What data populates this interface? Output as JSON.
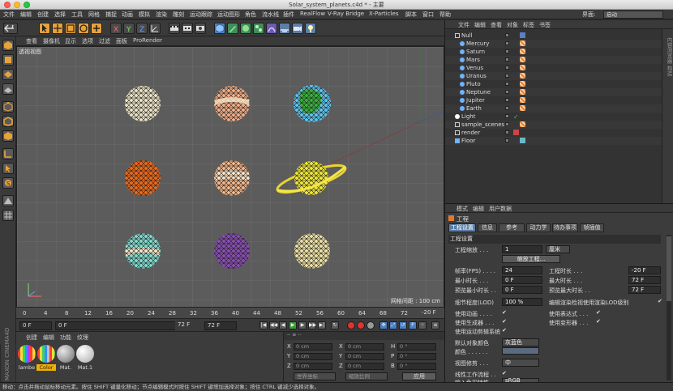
{
  "window": {
    "title": "Solar_system_planets.c4d * - 主要"
  },
  "menubar": {
    "items": [
      "文件",
      "编辑",
      "创建",
      "选择",
      "工具",
      "网格",
      "捕捉",
      "动画",
      "模拟",
      "渲染",
      "雕刻",
      "运动跟踪",
      "运动图形",
      "角色",
      "流水线",
      "插件",
      "RealFlow",
      "V-Ray Bridge",
      "X-Particles",
      "脚本",
      "窗口",
      "帮助"
    ],
    "layout_label": "界面:",
    "layout_value": "启动"
  },
  "toolbar": {
    "icons": [
      "undo-icon",
      "select-arrow-icon",
      "move-icon",
      "scale-icon",
      "rotate-icon",
      "add-icon",
      "x-axis-icon",
      "y-axis-icon",
      "z-axis-icon",
      "coordinate-system-icon",
      "render-view-icon",
      "render-picture-viewer-icon",
      "render-settings-icon",
      "cube-icon",
      "pen-icon",
      "subdivision-icon",
      "array-icon",
      "deformer-icon",
      "scene-icon",
      "camera-icon",
      "light-icon"
    ]
  },
  "viewport": {
    "menu": [
      "查看",
      "摄像机",
      "显示",
      "选项",
      "过滤",
      "面板",
      "ProRender"
    ],
    "label": "透视视图",
    "grid_spacing": "网格间距 : 100 cm",
    "colors": {
      "sky": "#5c5c5c",
      "grid": "#6a6a6a"
    }
  },
  "timeline": {
    "ticks": [
      "0",
      "4",
      "8",
      "12",
      "16",
      "20",
      "24",
      "28",
      "32",
      "36",
      "40",
      "44",
      "48",
      "52",
      "56",
      "60",
      "64",
      "68",
      "72"
    ],
    "current": "-20 F"
  },
  "transport": {
    "start_field": "0 F",
    "min_field": "0 F",
    "end_field": "72 F",
    "max_field": "72 F",
    "buttons": [
      "go-to-start-icon",
      "prev-key-icon",
      "prev-frame-icon",
      "play-icon",
      "next-frame-icon",
      "next-key-icon",
      "go-to-end-icon"
    ]
  },
  "material_panel": {
    "menu": [
      "创建",
      "编辑",
      "功能",
      "纹理"
    ],
    "materials": [
      {
        "label": "lambe",
        "color": "#7d5db6"
      },
      {
        "label": "Color",
        "color": "#2aa0b0",
        "selected": true
      },
      {
        "label": "Mat.",
        "color": "#aaaaaa"
      },
      {
        "label": "Mat.1",
        "color": "#f0f0f0"
      }
    ],
    "brand": "MAXON CINEMA4D"
  },
  "coord_panel": {
    "header": "--  ≡  --",
    "rows": [
      {
        "a": "X",
        "av": "0 cm",
        "b": "X",
        "bv": "0 cm",
        "c": "H",
        "cv": "0 °"
      },
      {
        "a": "Y",
        "av": "0 cm",
        "b": "Y",
        "bv": "0 cm",
        "c": "P",
        "cv": "0 °"
      },
      {
        "a": "Z",
        "av": "0 cm",
        "b": "Z",
        "bv": "0 cm",
        "c": "B",
        "cv": "0 °"
      }
    ],
    "mode_select": "世界坐标",
    "size_select": "缩放比例",
    "apply": "应用"
  },
  "object_manager": {
    "menu": [
      "文件",
      "编辑",
      "查看",
      "对象",
      "标签",
      "书签"
    ],
    "sidebar_label": "内容浏览器 构造",
    "objects": [
      {
        "name": "Null",
        "indent": 0,
        "icon_color": "#cfcfcf",
        "tag": "#5a7fc4"
      },
      {
        "name": "Mercury",
        "indent": 1,
        "icon_color": "#6fb3ff",
        "tag": "#e07a2e"
      },
      {
        "name": "Saturn",
        "indent": 1,
        "icon_color": "#6fb3ff",
        "tag": "#e07a2e"
      },
      {
        "name": "Mars",
        "indent": 1,
        "icon_color": "#6fb3ff",
        "tag": "#e07a2e"
      },
      {
        "name": "Venus",
        "indent": 1,
        "icon_color": "#6fb3ff",
        "tag": "#e07a2e"
      },
      {
        "name": "Uranus",
        "indent": 1,
        "icon_color": "#6fb3ff",
        "tag": "#e07a2e"
      },
      {
        "name": "Pluto",
        "indent": 1,
        "icon_color": "#6fb3ff",
        "tag": "#e07a2e"
      },
      {
        "name": "Neptune",
        "indent": 1,
        "icon_color": "#6fb3ff",
        "tag": "#e07a2e"
      },
      {
        "name": "Jupiter",
        "indent": 1,
        "icon_color": "#6fb3ff",
        "tag": "#e07a2e"
      },
      {
        "name": "Earth",
        "indent": 1,
        "icon_color": "#6fb3ff",
        "tag": "#e07a2e"
      },
      {
        "name": "Light",
        "indent": 0,
        "icon_color": "#ffffff",
        "tag": "#46c24a"
      },
      {
        "name": "sample_scenes",
        "indent": 0,
        "icon_color": "#cfcfcf",
        "tag": "#e07a2e"
      },
      {
        "name": "render",
        "indent": 0,
        "icon_color": "#cfcfcf",
        "tag": "#e07a2e"
      },
      {
        "name": "Floor",
        "indent": 0,
        "icon_color": "#6fb3ff",
        "tag": "#6bb8c8"
      }
    ]
  },
  "attribute_manager": {
    "menu": [
      "模式",
      "编辑",
      "用户数据"
    ],
    "title": "工程",
    "tabs": [
      "工程设置",
      "信息",
      "参考",
      "动力学",
      "待办事项",
      "帧插值"
    ],
    "section": "工程设置",
    "scale_label": "工程缩放 . . .",
    "scale_value": "1",
    "scale_unit": "厘米",
    "scale_button": "缩放工程...",
    "fps_label": "帧率(FPS) . . . .",
    "fps_value": "24",
    "duration_label": "工程时长 . . .",
    "duration_value": "-20 F",
    "min_time_label": "最小时长 . . .",
    "min_time_value": "0 F",
    "max_time_label": "最大时长 . . .",
    "max_time_value": "72 F",
    "preview_min_label": "预览最小时长 . .",
    "preview_min_value": "0 F",
    "preview_max_label": "预览最大时长 . .",
    "preview_max_value": "72 F",
    "lod_label": "细节程度(LOD)",
    "lod_value": "100 %",
    "lod_render_label": "编辑渲染检视使用渲染LOD级别",
    "use_anim_label": "使用动画 . . . .",
    "use_expr_label": "使用表达式 . . .",
    "use_gen_label": "使用生成器 . . .",
    "use_deform_label": "使用变形器 . . .",
    "use_motion_label": "使用运动剪辑系统",
    "default_color_label": "默认对象颜色",
    "default_color_value": "灰蓝色",
    "color_label": "颜色 . . . . . .",
    "view_clip_label": "视图修剪 . . .",
    "view_clip_value": "中",
    "linear_flow_label": "线性工作流程 . .",
    "input_profile_label": "输入色彩特性 . .",
    "input_profile_value": "sRGB"
  },
  "statusbar": {
    "text": "移动：点击并拖动鼠标移动元素。按住 SHIFT 键量化移动；节点编辑模式时按住 SHIFT 键增加选择对象；按住 CTRL 键减少选择对象。"
  }
}
